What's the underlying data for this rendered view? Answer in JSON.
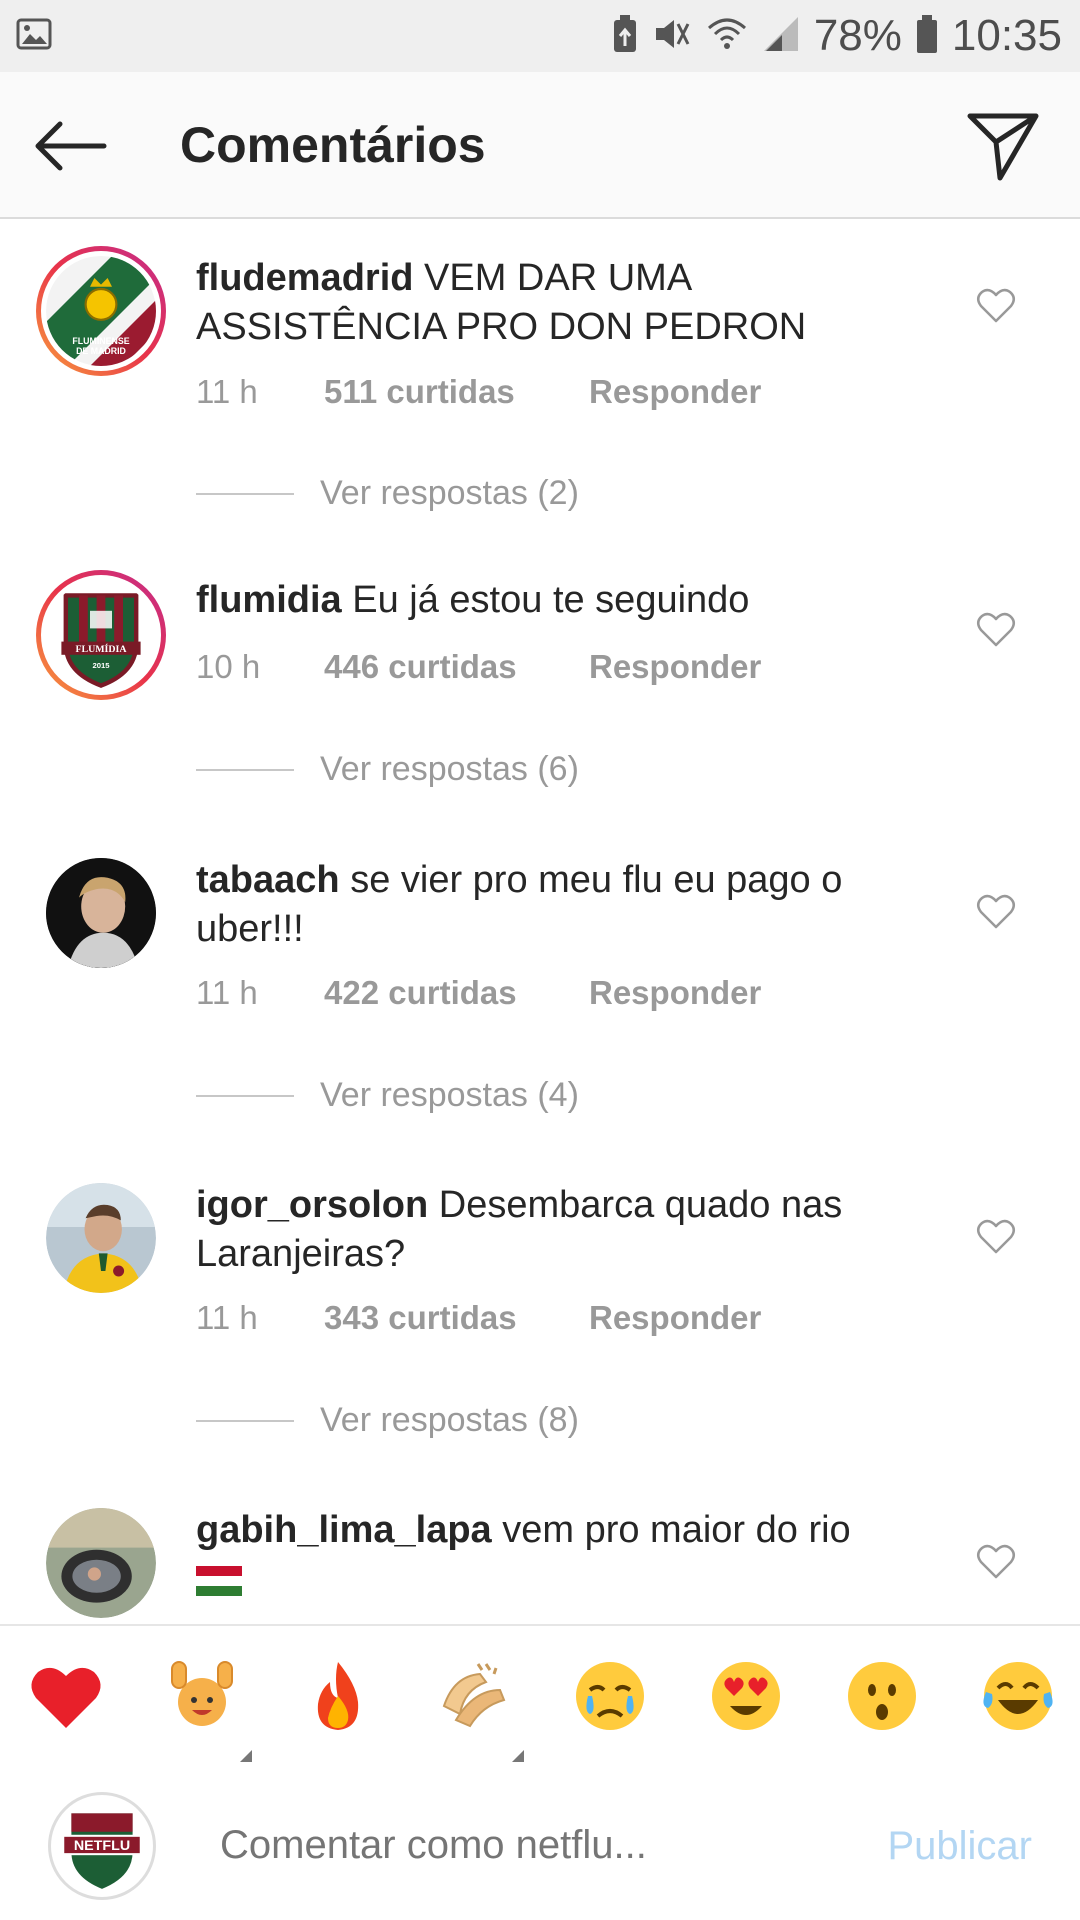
{
  "status_bar": {
    "battery": "78%",
    "time": "10:35"
  },
  "header": {
    "title": "Comentários"
  },
  "comments": [
    {
      "username": "fludemadrid",
      "text": "VEM DAR UMA ASSISTÊNCIA PRO DON PEDRON",
      "time": "11 h",
      "likes": "511 curtidas",
      "reply": "Responder",
      "view_replies": "Ver respostas (2)",
      "avatar_label_1": "FLUMINENSE",
      "avatar_label_2": "DE MADRID"
    },
    {
      "username": "flumidia",
      "text": "Eu já estou te seguindo",
      "time": "10 h",
      "likes": "446 curtidas",
      "reply": "Responder",
      "view_replies": "Ver respostas (6)",
      "avatar_label_1": "FLUMÍDIA",
      "avatar_label_2": "2015"
    },
    {
      "username": "tabaach",
      "text": "se vier pro meu flu eu pago o uber!!!",
      "time": "11 h",
      "likes": "422 curtidas",
      "reply": "Responder",
      "view_replies": "Ver respostas (4)"
    },
    {
      "username": "igor_orsolon",
      "text": "Desembarca quado nas Laranjeiras?",
      "time": "11 h",
      "likes": "343 curtidas",
      "reply": "Responder",
      "view_replies": "Ver respostas (8)"
    },
    {
      "username": "gabih_lima_lapa",
      "text": "vem pro maior do rio"
    }
  ],
  "emoji_bar": [
    "red-heart",
    "raising-hands",
    "fire",
    "clapping-hands",
    "crying-face",
    "heart-eyes-face",
    "surprised-face",
    "tears-of-joy-face"
  ],
  "compose": {
    "avatar_text": "NETFLU",
    "placeholder": "Comentar como netflu...",
    "publish": "Publicar"
  },
  "colors": {
    "text": "#262626",
    "muted": "#999999",
    "publish_disabled": "#b3d6f3",
    "story_ring_start": "#f9a03c",
    "story_ring_end": "#c32c8d"
  }
}
